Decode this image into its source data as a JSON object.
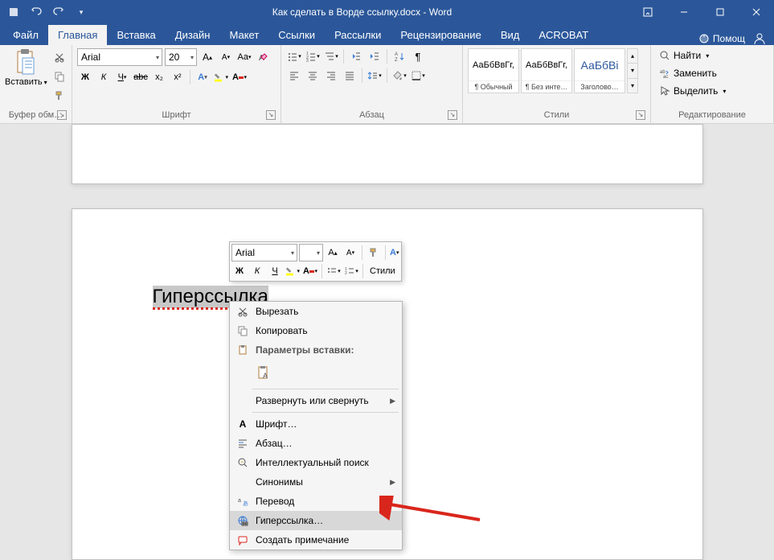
{
  "titlebar": {
    "document_title": "Как сделать в Ворде ссылку.docx - Word"
  },
  "tabs": {
    "file": "Файл",
    "items": [
      "Главная",
      "Вставка",
      "Дизайн",
      "Макет",
      "Ссылки",
      "Рассылки",
      "Рецензирование",
      "Вид",
      "ACROBAT"
    ],
    "active_index": 0,
    "help": "Помощ"
  },
  "ribbon": {
    "clipboard": {
      "paste": "Вставить",
      "label": "Буфер обм…"
    },
    "font": {
      "family": "Arial",
      "size": "20",
      "bold": "Ж",
      "italic": "К",
      "underline": "Ч",
      "strike": "abc",
      "sub": "x₂",
      "sup": "x²",
      "label": "Шрифт"
    },
    "paragraph": {
      "label": "Абзац"
    },
    "styles": {
      "label": "Стили",
      "items": [
        {
          "preview": "АаБбВвГг,",
          "name": "¶ Обычный",
          "color": "#000"
        },
        {
          "preview": "АаБбВвГг,",
          "name": "¶ Без инте…",
          "color": "#000"
        },
        {
          "preview": "АаБбВі",
          "name": "Заголово…",
          "color": "#2b579a"
        }
      ]
    },
    "editing": {
      "find": "Найти",
      "replace": "Заменить",
      "select": "Выделить",
      "label": "Редактирование"
    }
  },
  "document": {
    "selected_text": "Гиперссылка"
  },
  "mini_toolbar": {
    "font_family": "Arial",
    "styles": "Стили"
  },
  "context_menu": {
    "cut": "Вырезать",
    "copy": "Копировать",
    "paste_options": "Параметры вставки:",
    "expand_collapse": "Развернуть или свернуть",
    "font": "Шрифт…",
    "paragraph": "Абзац…",
    "smart_lookup": "Интеллектуальный поиск",
    "synonyms": "Синонимы",
    "translate": "Перевод",
    "hyperlink": "Гиперссылка…",
    "comment": "Создать примечание"
  }
}
